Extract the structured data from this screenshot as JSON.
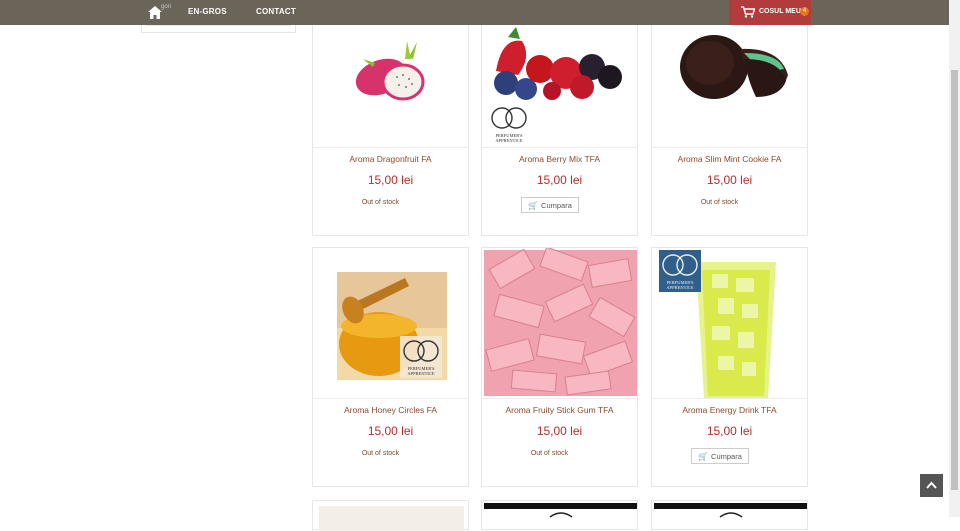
{
  "nav": {
    "items": [
      {
        "label": "EN-GROS"
      },
      {
        "label": "CONTACT"
      }
    ],
    "sub_text": "gori",
    "cart": {
      "label": "COSUL MEU",
      "count": "4"
    }
  },
  "products": [
    {
      "name": "Aroma Dragonfruit FA",
      "price": "15,00 lei",
      "status": "Out of stock"
    },
    {
      "name": "Aroma Berry Mix TFA",
      "price": "15,00 lei",
      "button": "Cumpara"
    },
    {
      "name": "Aroma Slim Mint Cookie FA",
      "price": "15,00 lei",
      "status": "Out of stock"
    },
    {
      "name": "Aroma Honey Circles FA",
      "price": "15,00 lei",
      "status": "Out of stock"
    },
    {
      "name": "Aroma Fruity Stick Gum TFA",
      "price": "15,00 lei",
      "status": "Out of stock"
    },
    {
      "name": "Aroma Energy Drink TFA",
      "price": "15,00 lei",
      "button": "Cumpara"
    }
  ],
  "badge_text": "PERFUMER'S APPRENTICE",
  "colors": {
    "nav_bg": "#6b6459",
    "cart_bg": "#b23b3b",
    "price": "#b0322e",
    "name": "#8a4b2e"
  }
}
